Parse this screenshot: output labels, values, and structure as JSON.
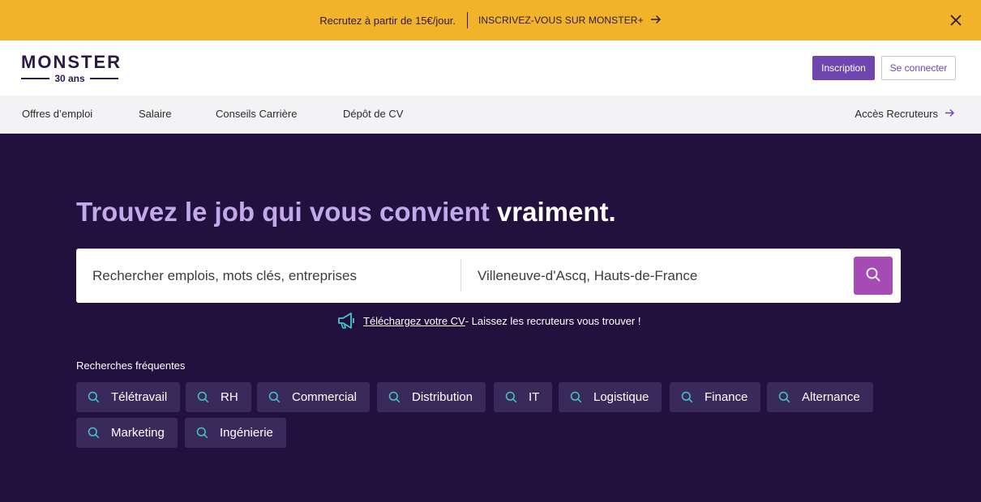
{
  "promo": {
    "message": "Recrutez à partir de 15€/jour.",
    "cta": "INSCRIVEZ-VOUS SUR MONSTER+",
    "cta_icon": "arrow-right-icon",
    "close_icon": "close-icon",
    "background": "#f0b32a"
  },
  "header": {
    "logo_word": "MONSTER",
    "logo_sub": "30 ans",
    "signup_label": "Inscription",
    "login_label": "Se connecter",
    "accent": "#6e46ae"
  },
  "nav": {
    "items": [
      "Offres d’emploi",
      "Salaire",
      "Conseils Carrière",
      "Dépôt de CV"
    ],
    "recruiters": "Accès Recruteurs"
  },
  "hero": {
    "headline_main": "Trouvez le job qui vous convient ",
    "headline_strong": "vraiment.",
    "search": {
      "what_placeholder": "Rechercher emplois, mots clés, entreprises",
      "where_value": "Villeneuve-d'Ascq, Hauts-de-France",
      "button_color": "#a64bb6"
    },
    "cv": {
      "link": "Téléchargez votre CV",
      "rest": " - Laissez les recruteurs vous trouver !"
    },
    "frequent": {
      "title": "Recherches fréquentes",
      "chips": [
        "Télétravail",
        "RH",
        "Commercial",
        "Distribution",
        "IT",
        "Logistique",
        "Finance",
        "Alternance",
        "Marketing",
        "Ingénierie"
      ]
    },
    "background": "#22103f"
  }
}
